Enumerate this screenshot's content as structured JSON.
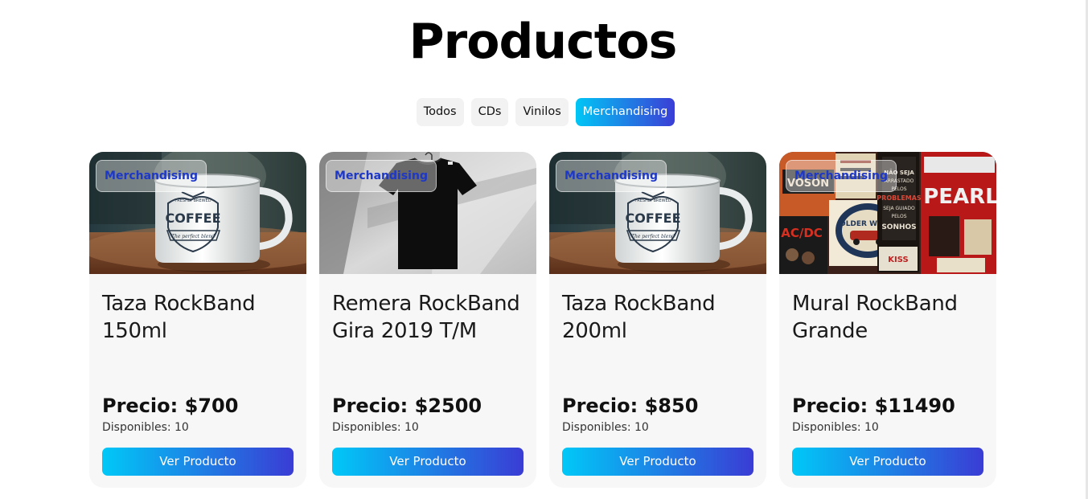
{
  "page": {
    "title": "Productos"
  },
  "filters": [
    {
      "label": "Todos",
      "active": false
    },
    {
      "label": "CDs",
      "active": false
    },
    {
      "label": "Vinilos",
      "active": false
    },
    {
      "label": "Merchandising",
      "active": true
    }
  ],
  "colors": {
    "accent_start": "#00c6f5",
    "accent_end": "#3b3ed6",
    "badge_text": "#1d37c7",
    "card_bg": "#f7f7f7"
  },
  "products": [
    {
      "category": "Merchandising",
      "name": "Taza RockBand 150ml",
      "price": "Precio: $700",
      "stock": "Disponibles: 10",
      "button": "Ver Producto",
      "image": "coffee-mug-photo",
      "image_text": {
        "line1": "FRESHLY BREWED",
        "line2": "COFFEE",
        "line3": "The perfect blend"
      }
    },
    {
      "category": "Merchandising",
      "name": "Remera RockBand Gira 2019 T/M",
      "price": "Precio: $2500",
      "stock": "Disponibles: 10",
      "button": "Ver Producto",
      "image": "black-tshirt-photo"
    },
    {
      "category": "Merchandising",
      "name": "Taza RockBand 200ml",
      "price": "Precio: $850",
      "stock": "Disponibles: 10",
      "button": "Ver Producto",
      "image": "coffee-mug-photo",
      "image_text": {
        "line1": "FRESHLY BREWED",
        "line2": "COFFEE",
        "line3": "The perfect blend"
      }
    },
    {
      "category": "Merchandising",
      "name": "Mural RockBand Grande",
      "price": "Precio: $11490",
      "stock": "Disponibles: 10",
      "button": "Ver Producto",
      "image": "rock-posters-wall-photo",
      "image_text": {
        "sign1": "NÃO SEJA ARRASTADO PELOS PROBLEMAS SEJA GUIADO PELOS SONHOS",
        "sign2": "PEARL",
        "sign3": "AC/DC",
        "sign4": "OLDER WISER",
        "sign5": "KISS",
        "sign6": "VOSON"
      }
    }
  ]
}
